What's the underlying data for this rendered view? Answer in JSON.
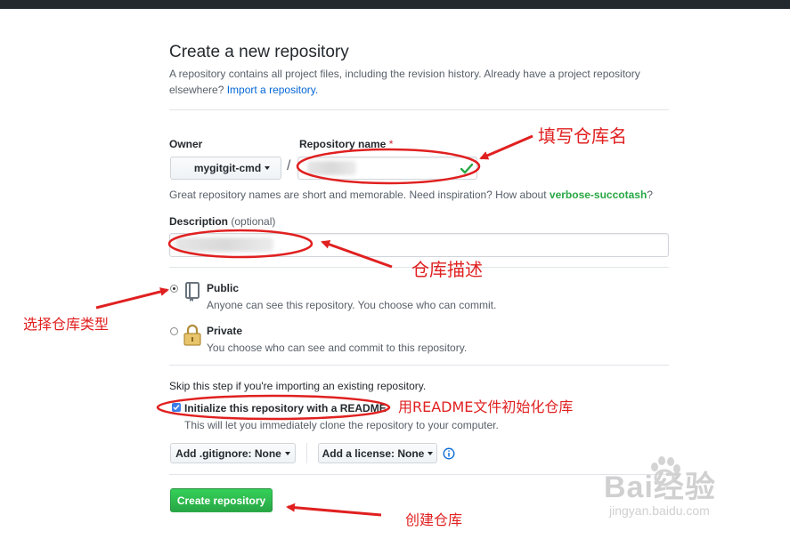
{
  "page": {
    "title": "Create a new repository",
    "intro_text": "A repository contains all project files, including the revision history. Already have a project repository elsewhere?",
    "import_link": "Import a repository."
  },
  "form": {
    "owner_label": "Owner",
    "owner_value": "mygitgit-cmd",
    "separator": "/",
    "repo_name_label": "Repository name",
    "repo_name_required": "*",
    "name_hint_prefix": "Great repository names are short and memorable. Need inspiration? How about",
    "name_suggestion": "verbose-succotash",
    "name_hint_suffix": "?",
    "description_label": "Description",
    "description_optional": "(optional)"
  },
  "visibility": {
    "selected": "Public",
    "options": [
      {
        "title": "Public",
        "desc": "Anyone can see this repository. You choose who can commit."
      },
      {
        "title": "Private",
        "desc": "You choose who can see and commit to this repository."
      }
    ]
  },
  "init": {
    "skip_text": "Skip this step if you're importing an existing repository.",
    "readme_label": "Initialize this repository with a README",
    "readme_checked": true,
    "readme_desc": "This will let you immediately clone the repository to your computer.",
    "gitignore_label": "Add .gitignore: None",
    "license_label": "Add a license: None",
    "info_icon": "info-icon"
  },
  "actions": {
    "create_label": "Create repository"
  },
  "annotations": {
    "repo_name": "填写仓库名",
    "description": "仓库描述",
    "type": "选择仓库类型",
    "readme": "用README文件初始化仓库",
    "create": "创建仓库"
  },
  "watermark": {
    "brand": "Bai经验",
    "url": "jingyan.baidu.com"
  },
  "colors": {
    "annotation_red": "#e02020",
    "primary_green": "#28a745",
    "link_blue": "#0366d6",
    "topbar": "#24292e"
  }
}
